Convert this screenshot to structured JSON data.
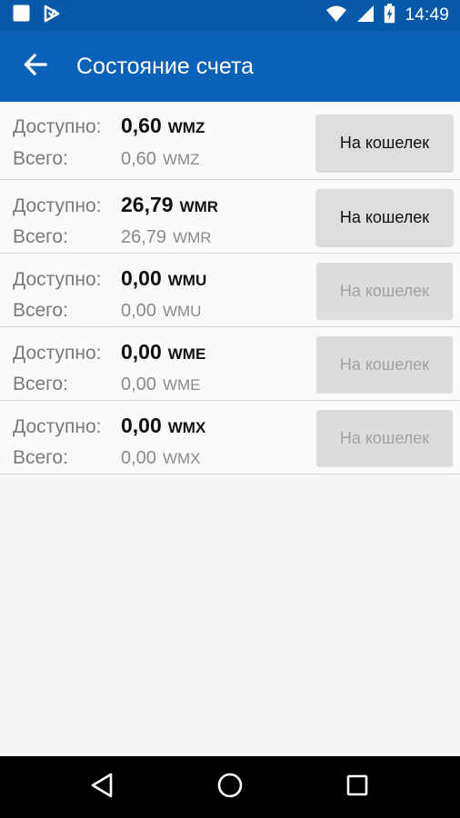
{
  "status_bar": {
    "time": "14:49",
    "icons": [
      "notification-square-icon",
      "download-app-icon",
      "wifi-icon",
      "signal-icon",
      "battery-charging-icon"
    ]
  },
  "app_bar": {
    "title": "Состояние счета",
    "back_icon": "arrow-left-icon",
    "color": "#0a62b8"
  },
  "accounts": [
    {
      "available_label": "Доступно:",
      "available_amount": "0,60",
      "available_currency": "WMZ",
      "total_label": "Всего:",
      "total_amount": "0,60",
      "total_currency": "WMZ",
      "button_label": "На кошелек",
      "button_enabled": true
    },
    {
      "available_label": "Доступно:",
      "available_amount": "26,79",
      "available_currency": "WMR",
      "total_label": "Всего:",
      "total_amount": "26,79",
      "total_currency": "WMR",
      "button_label": "На кошелек",
      "button_enabled": true
    },
    {
      "available_label": "Доступно:",
      "available_amount": "0,00",
      "available_currency": "WMU",
      "total_label": "Всего:",
      "total_amount": "0,00",
      "total_currency": "WMU",
      "button_label": "На кошелек",
      "button_enabled": false
    },
    {
      "available_label": "Доступно:",
      "available_amount": "0,00",
      "available_currency": "WME",
      "total_label": "Всего:",
      "total_amount": "0,00",
      "total_currency": "WME",
      "button_label": "На кошелек",
      "button_enabled": false
    },
    {
      "available_label": "Доступно:",
      "available_amount": "0,00",
      "available_currency": "WMX",
      "total_label": "Всего:",
      "total_amount": "0,00",
      "total_currency": "WMX",
      "button_label": "На кошелек",
      "button_enabled": false
    }
  ],
  "nav_bar": {
    "icons": [
      "back-triangle-icon",
      "home-circle-icon",
      "recents-square-icon"
    ]
  }
}
